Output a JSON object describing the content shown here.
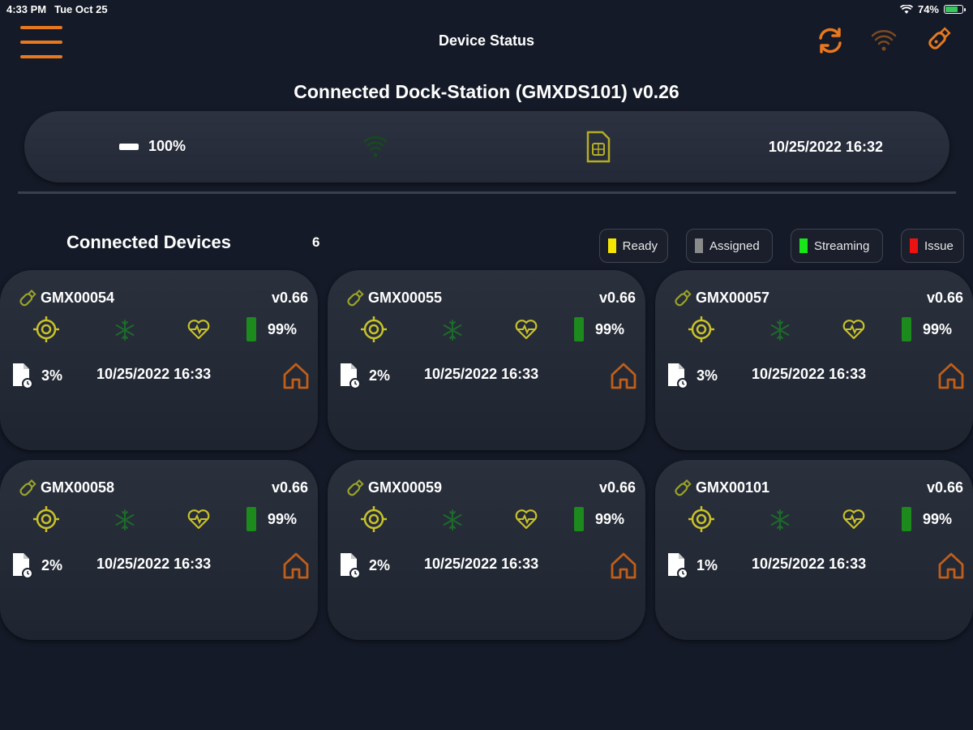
{
  "status_bar": {
    "time": "4:33 PM",
    "date": "Tue Oct 25",
    "battery": "74%",
    "battery_level": 0.74
  },
  "nav": {
    "title": "Device Status",
    "icons": [
      "menu-icon",
      "refresh-icon",
      "wifi-icon",
      "usb-stick-icon"
    ]
  },
  "dock": {
    "title": "Connected Dock-Station (GMXDS101) v0.26",
    "battery": "100%",
    "timestamp": "10/25/2022 16:32"
  },
  "devices_section": {
    "label": "Connected Devices",
    "count": "6"
  },
  "legend": [
    {
      "label": "Ready",
      "color": "#f5e600"
    },
    {
      "label": "Assigned",
      "color": "#8a8a8a"
    },
    {
      "label": "Streaming",
      "color": "#19e619"
    },
    {
      "label": "Issue",
      "color": "#ee1111"
    }
  ],
  "colors": {
    "accent": "#e8781e",
    "icon_yellow": "#c9c22a",
    "icon_green": "#1d8a1d"
  },
  "devices": [
    {
      "id": "GMX00054",
      "version": "v0.66",
      "battery": "99%",
      "storage": "3%",
      "timestamp": "10/25/2022 16:33"
    },
    {
      "id": "GMX00055",
      "version": "v0.66",
      "battery": "99%",
      "storage": "2%",
      "timestamp": "10/25/2022 16:33"
    },
    {
      "id": "GMX00057",
      "version": "v0.66",
      "battery": "99%",
      "storage": "3%",
      "timestamp": "10/25/2022 16:33"
    },
    {
      "id": "GMX00058",
      "version": "v0.66",
      "battery": "99%",
      "storage": "2%",
      "timestamp": "10/25/2022 16:33"
    },
    {
      "id": "GMX00059",
      "version": "v0.66",
      "battery": "99%",
      "storage": "2%",
      "timestamp": "10/25/2022 16:33"
    },
    {
      "id": "GMX00101",
      "version": "v0.66",
      "battery": "99%",
      "storage": "1%",
      "timestamp": "10/25/2022 16:33"
    }
  ]
}
